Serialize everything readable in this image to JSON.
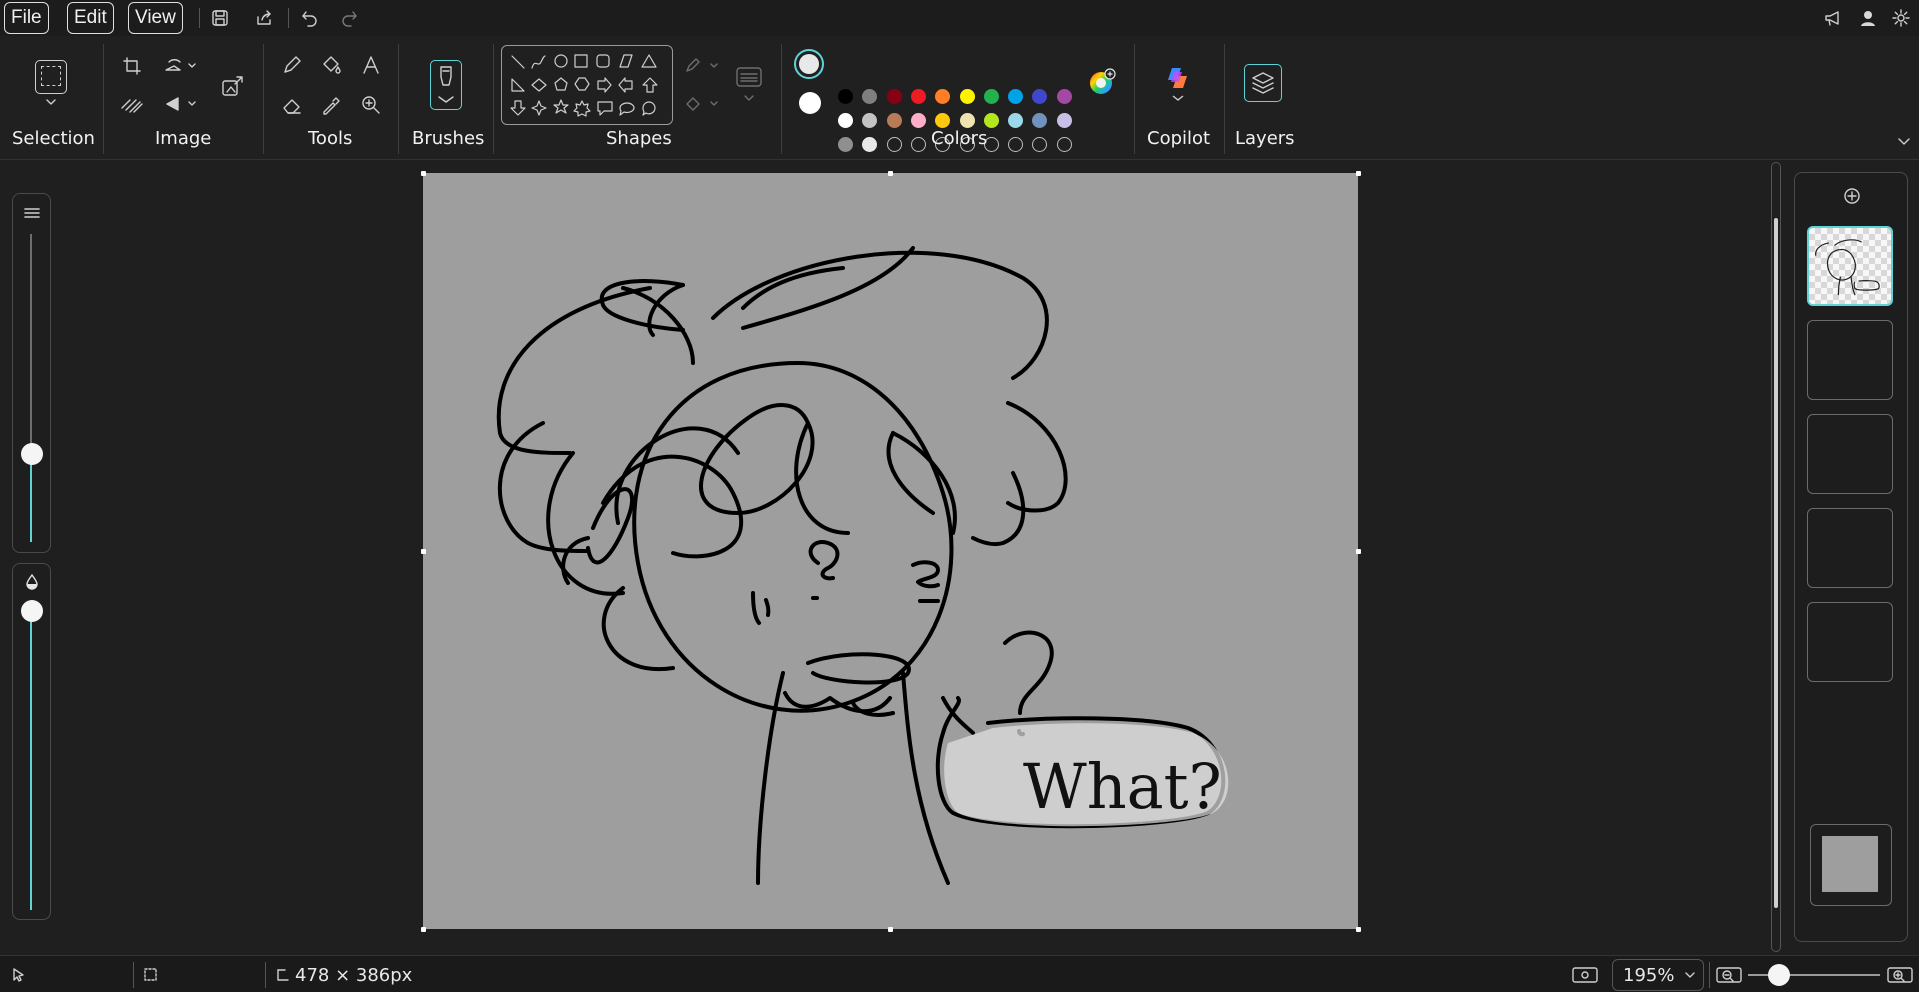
{
  "menu": {
    "file": "File",
    "edit": "Edit",
    "view": "View"
  },
  "ribbon": {
    "groups": {
      "selection": "Selection",
      "image": "Image",
      "tools": "Tools",
      "brushes": "Brushes",
      "shapes": "Shapes",
      "colors": "Colors",
      "copilot": "Copilot",
      "layers": "Layers"
    },
    "colors": {
      "primary": "#e8e8e8",
      "secondary": "#ffffff",
      "row1": [
        "#000000",
        "#7f7f7f",
        "#880015",
        "#ed1c24",
        "#ff7f27",
        "#fff200",
        "#22b14c",
        "#00a2e8",
        "#3f48cc",
        "#a349a4"
      ],
      "row2": [
        "#ffffff",
        "#c3c3c3",
        "#b97a57",
        "#ffaec9",
        "#ffc90e",
        "#efe4b0",
        "#b5e61d",
        "#99d9ea",
        "#7092be",
        "#c8bfe7"
      ],
      "row3": [
        "#8f8f8f",
        "#e8e8e8",
        "",
        "",
        "",
        "",
        "",
        "",
        "",
        ""
      ]
    }
  },
  "canvas": {
    "background": "#9e9e9e",
    "speech_text": "What?"
  },
  "status": {
    "canvas_size": "478 × 386px",
    "zoom": "195%"
  },
  "accent": "#5fd3d8"
}
